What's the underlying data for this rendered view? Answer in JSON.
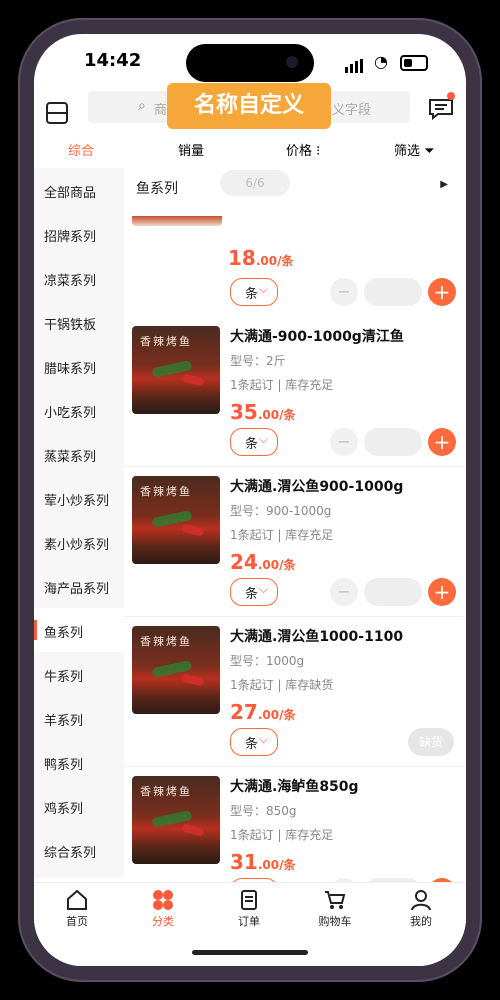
{
  "status": {
    "time": "14:42"
  },
  "header": {
    "search_left": "商",
    "search_right": "义字段",
    "custom_label": "名称自定义"
  },
  "sort": {
    "items": [
      "综合",
      "销量",
      "价格 ⁝",
      "筛选"
    ],
    "active_index": 0
  },
  "sidebar": {
    "items": [
      "全部商品",
      "招牌系列",
      "凉菜系列",
      "干锅铁板",
      "腊味系列",
      "小吃系列",
      "蒸菜系列",
      "荤小炒系列",
      "素小炒系列",
      "海产品系列",
      "鱼系列",
      "牛系列",
      "羊系列",
      "鸭系列",
      "鸡系列",
      "综合系列"
    ],
    "active": "鱼系列"
  },
  "content": {
    "series_title": "鱼系列",
    "page_indicator": "6/6",
    "first_price_int": "18",
    "first_price_dec": ".00/条",
    "first_unit": "条"
  },
  "products": [
    {
      "name": "大满通-900-1000g清江鱼",
      "model": "型号：2斤",
      "stock": "1条起订 | 库存充足",
      "price_int": "35",
      "price_dec": ".00/条",
      "unit": "条",
      "thumb_text": "香辣烤鱼",
      "sold_out": false
    },
    {
      "name": "大满通.渭公鱼900-1000g",
      "model": "型号：900-1000g",
      "stock": "1条起订 | 库存充足",
      "price_int": "24",
      "price_dec": ".00/条",
      "unit": "条",
      "thumb_text": "香辣烤鱼",
      "sold_out": false
    },
    {
      "name": "大满通.渭公鱼1000-1100",
      "model": "型号：1000g",
      "stock": "1条起订 | 库存缺货",
      "price_int": "27",
      "price_dec": ".00/条",
      "unit": "条",
      "thumb_text": "香辣烤鱼",
      "sold_out": true,
      "sold_out_label": "缺货"
    },
    {
      "name": "大满通.海鲈鱼850g",
      "model": "型号：850g",
      "stock": "1条起订 | 库存充足",
      "price_int": "31",
      "price_dec": ".00/条",
      "unit": "条",
      "thumb_text": "香辣烤鱼",
      "sold_out": false
    }
  ],
  "tabs": [
    {
      "label": "首页",
      "icon": "home-icon"
    },
    {
      "label": "分类",
      "icon": "category-icon"
    },
    {
      "label": "订单",
      "icon": "order-icon"
    },
    {
      "label": "购物车",
      "icon": "cart-icon"
    },
    {
      "label": "我的",
      "icon": "user-icon"
    }
  ],
  "tab_active_index": 1,
  "colors": {
    "accent": "#ff6a3d",
    "badge": "#f5a73a",
    "price": "#ff5b3a"
  }
}
